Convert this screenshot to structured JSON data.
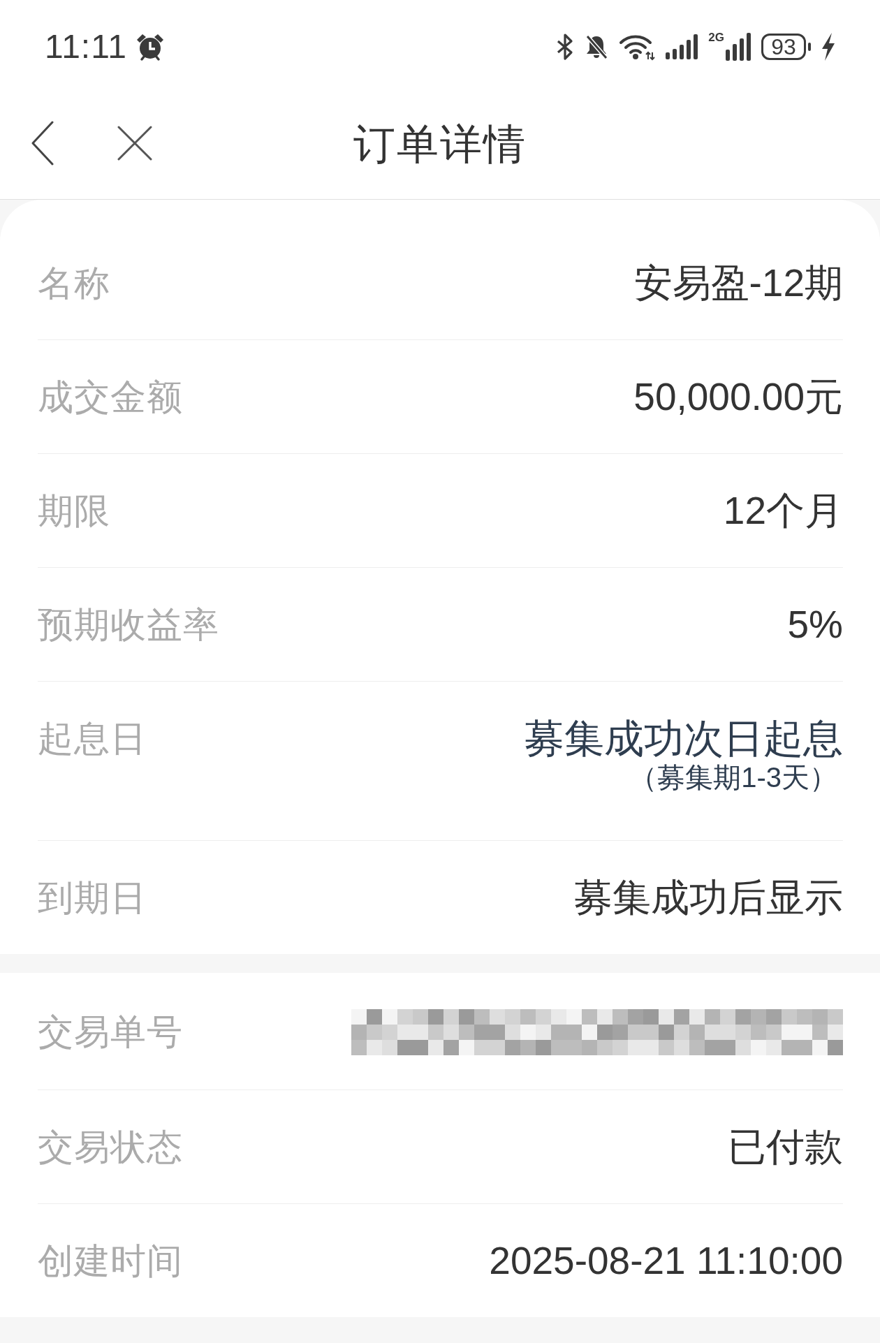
{
  "status_bar": {
    "time": "11:11",
    "network_type": "2G",
    "battery": "93"
  },
  "nav": {
    "title": "订单详情"
  },
  "sections": [
    {
      "rows": [
        {
          "kind": "plain",
          "label": "名称",
          "value": "安易盈-12期"
        },
        {
          "kind": "plain",
          "label": "成交金额",
          "value": "50,000.00元"
        },
        {
          "kind": "plain",
          "label": "期限",
          "value": "12个月"
        },
        {
          "kind": "plain",
          "label": "预期收益率",
          "value": "5%"
        },
        {
          "kind": "note",
          "label": "起息日",
          "value": "募集成功次日起息",
          "note": "（募集期1-3天）"
        },
        {
          "kind": "plain",
          "label": "到期日",
          "value": "募集成功后显示"
        }
      ]
    },
    {
      "rows": [
        {
          "kind": "redacted",
          "label": "交易单号"
        },
        {
          "kind": "plain",
          "label": "交易状态",
          "value": "已付款"
        },
        {
          "kind": "plain",
          "label": "创建时间",
          "value": "2025-08-21 11:10:00"
        }
      ]
    }
  ]
}
